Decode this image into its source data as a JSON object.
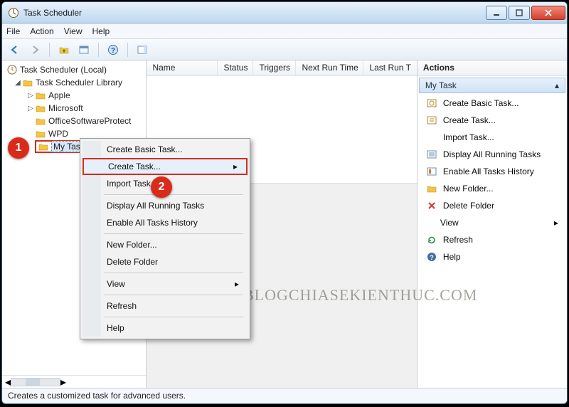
{
  "window": {
    "title": "Task Scheduler"
  },
  "menu": {
    "file": "File",
    "action": "Action",
    "view": "View",
    "help": "Help"
  },
  "tree": {
    "root": "Task Scheduler (Local)",
    "lib": "Task Scheduler Library",
    "items": [
      "Apple",
      "Microsoft",
      "OfficeSoftwareProtect",
      "WPD",
      "My Task"
    ]
  },
  "columns": {
    "name": "Name",
    "status": "Status",
    "triggers": "Triggers",
    "next": "Next Run Time",
    "last": "Last Run T"
  },
  "context": {
    "create_basic": "Create Basic Task...",
    "create_task": "Create Task...",
    "import": "Import Task...",
    "display_running": "Display All Running Tasks",
    "enable_history": "Enable All Tasks History",
    "new_folder": "New Folder...",
    "delete_folder": "Delete Folder",
    "view": "View",
    "refresh": "Refresh",
    "help": "Help"
  },
  "actions": {
    "title": "Actions",
    "subtitle": "My Task",
    "create_basic": "Create Basic Task...",
    "create_task": "Create Task...",
    "import": "Import Task...",
    "display_running": "Display All Running Tasks",
    "enable_history": "Enable All Tasks History",
    "new_folder": "New Folder...",
    "delete_folder": "Delete Folder",
    "view": "View",
    "refresh": "Refresh",
    "help": "Help"
  },
  "status": {
    "text": "Creates a customized task for advanced users."
  },
  "badges": {
    "b1": "1",
    "b2": "2"
  },
  "watermark": "BLOGCHIASEKIENTHUC.COM"
}
